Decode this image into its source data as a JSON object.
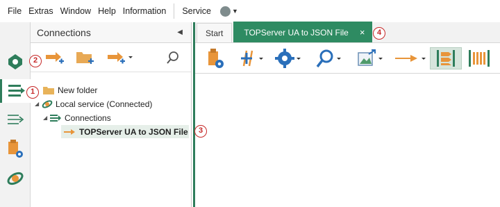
{
  "menubar": {
    "items": [
      "File",
      "Extras",
      "Window",
      "Help",
      "Information"
    ],
    "service_label": "Service",
    "service_status_color": "#7f8c8d"
  },
  "leftbar": {
    "icons": [
      "puzzle-icon",
      "connections-nav-icon",
      "list-nav-icon",
      "documents-settings-icon",
      "service-ring-icon"
    ],
    "active": "connections-nav-icon"
  },
  "connections_panel": {
    "title": "Connections",
    "toolbar": [
      "new-connection-icon",
      "new-folder-icon",
      "new-connection-dropdown-icon",
      "search-icon"
    ],
    "tree": {
      "folder": "New folder",
      "service": "Local service (Connected)",
      "connections_group": "Connections",
      "selected_connection": "TOPServer UA to JSON File"
    }
  },
  "tabs": [
    {
      "label": "Start",
      "active": false
    },
    {
      "label": "TOPServer UA to JSON File",
      "active": true,
      "close": "×"
    }
  ],
  "main_toolbar": [
    "data-source-settings-icon",
    "add-mapping-icon",
    "settings-gear-icon",
    "search-icon",
    "image-export-icon",
    "pipeline-arrow-icon",
    "filter-list-icon",
    "bar-columns-icon"
  ],
  "callouts": {
    "c1": "1",
    "c2": "2",
    "c3": "3",
    "c4": "4"
  },
  "colors": {
    "accent_green": "#2e8b62",
    "icon_orange": "#e8953a",
    "icon_blue": "#2a6fba",
    "callout_red": "#c62828"
  }
}
